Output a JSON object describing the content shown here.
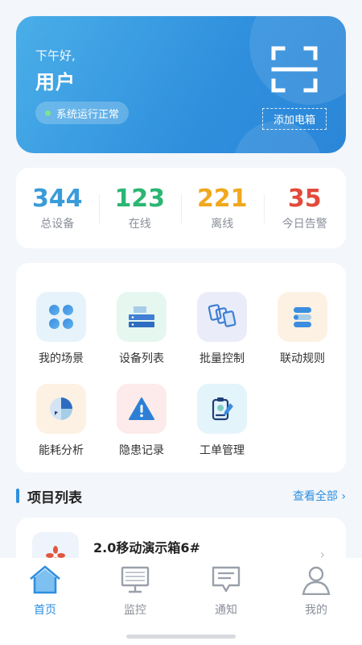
{
  "hero": {
    "greeting": "下午好,",
    "username": "用户",
    "status": "系统运行正常",
    "add_box_label": "添加电箱"
  },
  "stats": [
    {
      "value": "344",
      "label": "总设备",
      "color": "#3a9bd9"
    },
    {
      "value": "123",
      "label": "在线",
      "color": "#2bb673"
    },
    {
      "value": "221",
      "label": "离线",
      "color": "#f0a81e"
    },
    {
      "value": "35",
      "label": "今日告警",
      "color": "#e24a3b"
    }
  ],
  "functions": [
    {
      "label": "我的场景",
      "icon": "scene-icon"
    },
    {
      "label": "设备列表",
      "icon": "device-list-icon"
    },
    {
      "label": "批量控制",
      "icon": "batch-control-icon"
    },
    {
      "label": "联动规则",
      "icon": "linkage-rule-icon"
    },
    {
      "label": "能耗分析",
      "icon": "energy-analysis-icon"
    },
    {
      "label": "隐患记录",
      "icon": "hazard-record-icon"
    },
    {
      "label": "工单管理",
      "icon": "work-order-icon"
    }
  ],
  "section": {
    "title": "项目列表",
    "view_all": "查看全部 ›"
  },
  "project": {
    "name": "2.0移动演示箱6#"
  },
  "tabs": [
    {
      "label": "首页",
      "icon": "home-icon",
      "active": true
    },
    {
      "label": "监控",
      "icon": "monitor-icon",
      "active": false
    },
    {
      "label": "通知",
      "icon": "notification-icon",
      "active": false
    },
    {
      "label": "我的",
      "icon": "profile-icon",
      "active": false
    }
  ],
  "colors": {
    "accent": "#2d8fe0",
    "hero_start": "#4aaee8",
    "hero_end": "#2b86d8"
  }
}
